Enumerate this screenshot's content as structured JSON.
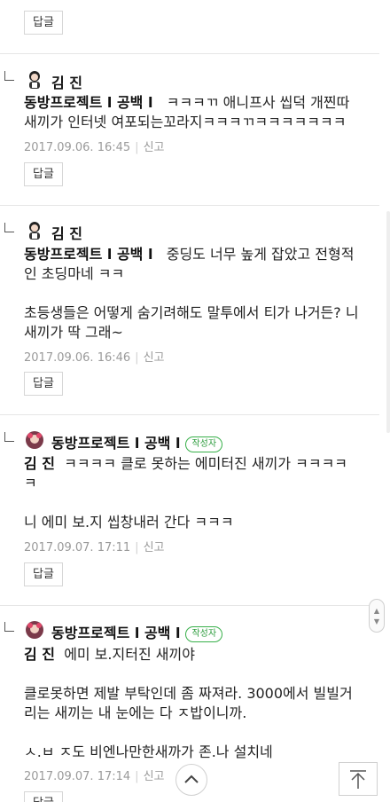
{
  "reply_label": "답글",
  "report_label": "신고",
  "author_badge": "작성자",
  "comments": [
    {
      "author": "김 진",
      "mention": "동방프로젝트 l 공백 l",
      "lines": [
        "ㅋㅋㅋㄲ 애니프사 씹덕 개찐따",
        "새끼가 인터넷 여포되는꼬라지ㅋㅋㅋㄲㅋㅋㅋㅋㅋㅋㅋ"
      ],
      "date": "2017.09.06. 16:45"
    },
    {
      "author": "김 진",
      "mention": "동방프로젝트 l 공백 l",
      "lines": [
        "중딩도 너무 높게 잡았고 전형적",
        "인 초딩마네 ㅋㅋ",
        "",
        "초등생들은 어떻게 숨기려해도 말투에서 티가 나거든? 니",
        "새끼가 딱 그래~"
      ],
      "date": "2017.09.06. 16:46"
    },
    {
      "author": "동방프로젝트 l 공백 l",
      "mention": "김 진",
      "lines": [
        "ㅋㅋㅋㅋ 클로 못하는 에미터진 새끼가 ㅋㅋㅋㅋ",
        "ㅋ",
        "",
        "니 에미 보.지 씹창내러 간다 ㅋㅋㅋ"
      ],
      "date": "2017.09.07. 17:11"
    },
    {
      "author": "동방프로젝트 l 공백 l",
      "mention": "김 진",
      "lines": [
        "에미 보.지터진 새끼야",
        "",
        "클로못하면 제발 부탁인데 좀 짜져라. 3000에서 빌빌거",
        "리는 새끼는 내 눈에는 다 ㅈ밥이니까.",
        "",
        "ㅅ.ㅂ ㅈ도 비엔나만한새까가 존.나 설치네"
      ],
      "date": "2017.09.07. 17:14"
    }
  ]
}
